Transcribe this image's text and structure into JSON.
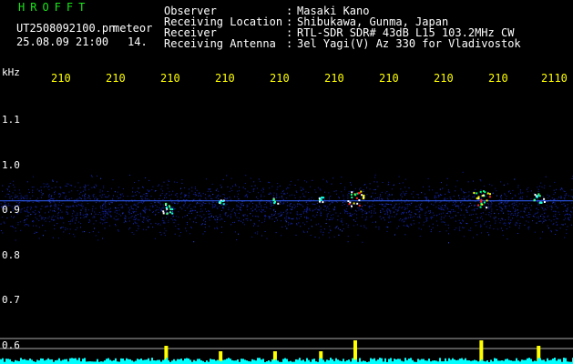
{
  "header": {
    "brand": "HROFFT",
    "filename": "UT2508092100.pn",
    "meteor_label": "meteor",
    "datetime": "25.08.09 21:00",
    "count": "14.",
    "info": [
      {
        "label": "Observer",
        "value": "Masaki Kano"
      },
      {
        "label": "Receiving Location",
        "value": "Shibukawa, Gunma, Japan"
      },
      {
        "label": "Receiver",
        "value": "RTL-SDR SDR# 43dB L15 103.2MHz CW"
      },
      {
        "label": "Receiving Antenna",
        "value": "3el Yagi(V) Az 330 for Vladivostok"
      }
    ]
  },
  "axis": {
    "unit": "kHz",
    "x_ticks": [
      "210",
      "210",
      "210",
      "210",
      "210",
      "210",
      "210",
      "210",
      "210",
      "2110"
    ],
    "y_ticks": [
      "1.1",
      "1.0",
      "0.9",
      "0.8",
      "0.7",
      "0.6"
    ]
  },
  "colors": {
    "background": "#000000",
    "text": "#ffffff",
    "brand": "#19e619",
    "tick": "#ffff00",
    "noise": "#1020a0",
    "signal": "#ff2020",
    "level": "#00ffff",
    "peak": "#ffff00"
  },
  "echoes": [
    {
      "freq": 0.905,
      "time_frac": 0.29,
      "strength": "medium"
    },
    {
      "freq": 0.92,
      "time_frac": 0.385,
      "strength": "weak"
    },
    {
      "freq": 0.92,
      "time_frac": 0.48,
      "strength": "weak"
    },
    {
      "freq": 0.925,
      "time_frac": 0.56,
      "strength": "weak"
    },
    {
      "freq": 0.925,
      "time_frac": 0.62,
      "strength": "strong"
    },
    {
      "freq": 0.925,
      "time_frac": 0.84,
      "strength": "strong"
    },
    {
      "freq": 0.925,
      "time_frac": 0.94,
      "strength": "medium"
    }
  ]
}
